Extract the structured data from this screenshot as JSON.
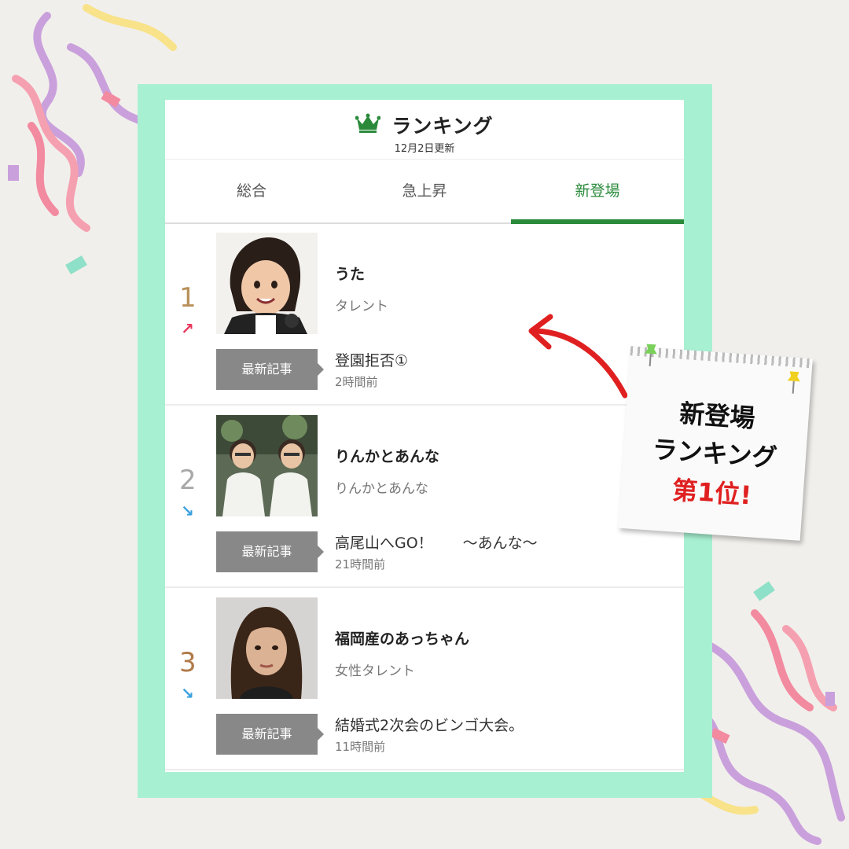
{
  "header": {
    "icon": "crown-icon",
    "title": "ランキング",
    "updated": "12月2日更新"
  },
  "tabs": [
    {
      "label": "総合",
      "active": false
    },
    {
      "label": "急上昇",
      "active": false
    },
    {
      "label": "新登場",
      "active": true
    }
  ],
  "colors": {
    "accent_green": "#2a8a3a",
    "frame_mint": "#a8f0d2",
    "rank_gold": "#b8905a",
    "rank_silver": "#a8a8a8",
    "rank_bronze": "#b07a48",
    "arrow_up": "#e8365a",
    "arrow_down": "#3aa0e0",
    "note_highlight": "#e02020"
  },
  "ranking": [
    {
      "rank": "1",
      "trend_icon": "arrow-up-right-icon",
      "trend": "↗",
      "name": "うた",
      "category": "タレント",
      "badge": "最新記事",
      "article_title": "登園拒否①",
      "article_time": "2時間前"
    },
    {
      "rank": "2",
      "trend_icon": "arrow-down-right-icon",
      "trend": "↘",
      "name": "りんかとあんな",
      "category": "りんかとあんな",
      "badge": "最新記事",
      "article_title": "高尾山へGO！　　〜あんな〜",
      "article_time": "21時間前"
    },
    {
      "rank": "3",
      "trend_icon": "arrow-down-right-icon",
      "trend": "↘",
      "name": "福岡産のあっちゃん",
      "category": "女性タレント",
      "badge": "最新記事",
      "article_title": "結婚式2次会のビンゴ大会。",
      "article_time": "11時間前"
    }
  ],
  "note": {
    "line1": "新登場",
    "line2": "ランキング",
    "line3": "第1位!"
  }
}
